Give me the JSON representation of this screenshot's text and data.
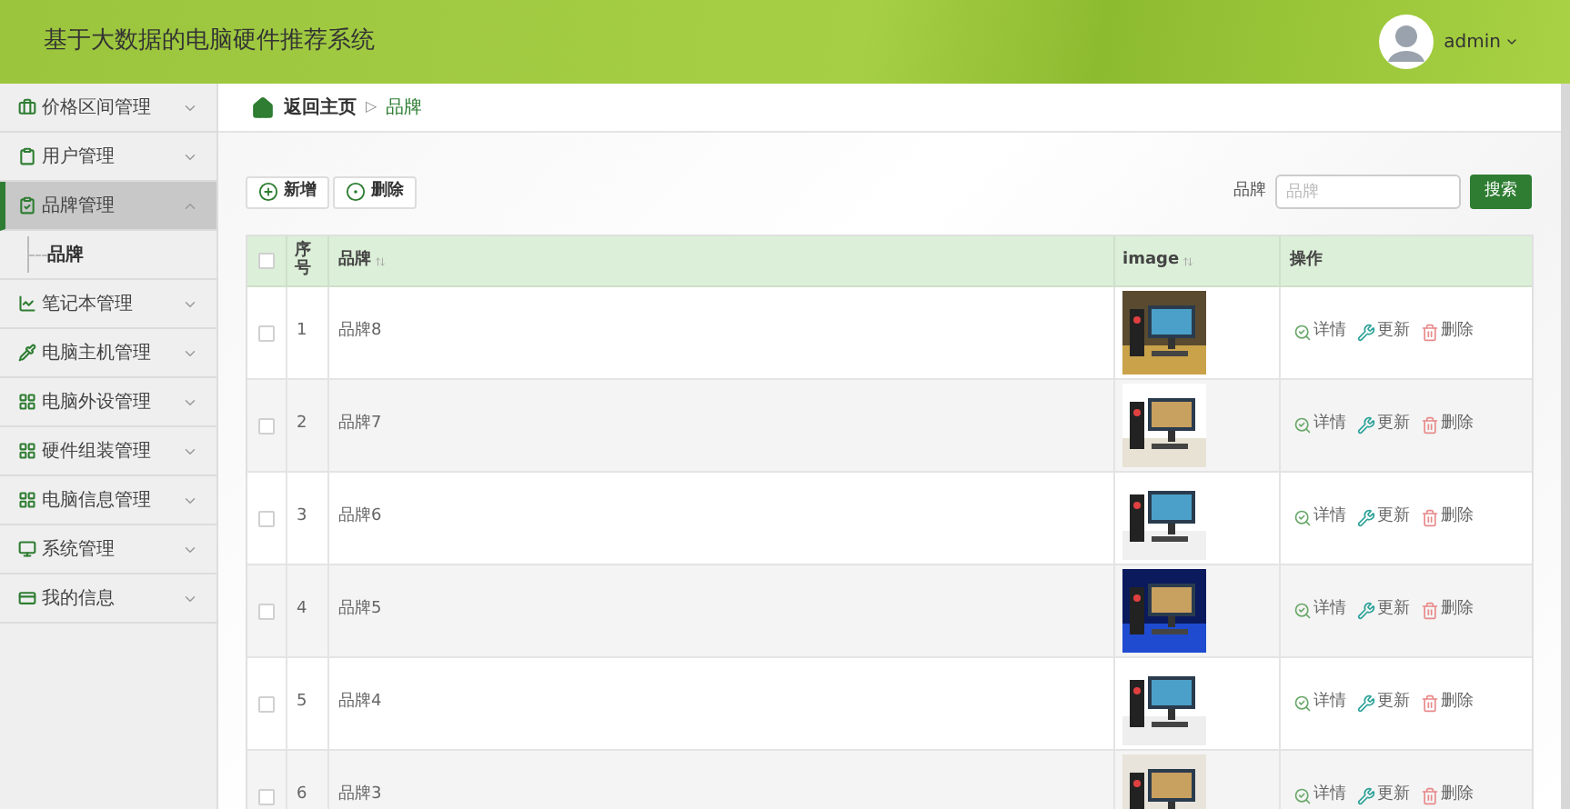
{
  "header": {
    "title": "基于大数据的电脑硬件推荐系统",
    "user": "admin"
  },
  "sidebar": {
    "items": [
      {
        "label": "价格区间管理",
        "expanded": false,
        "selected": false
      },
      {
        "label": "用户管理",
        "expanded": false,
        "selected": false
      },
      {
        "label": "品牌管理",
        "expanded": true,
        "selected": true,
        "children": [
          {
            "label": "品牌"
          }
        ]
      },
      {
        "label": "笔记本管理",
        "expanded": false,
        "selected": false
      },
      {
        "label": "电脑主机管理",
        "expanded": false,
        "selected": false
      },
      {
        "label": "电脑外设管理",
        "expanded": false,
        "selected": false
      },
      {
        "label": "硬件组装管理",
        "expanded": false,
        "selected": false
      },
      {
        "label": "电脑信息管理",
        "expanded": false,
        "selected": false
      },
      {
        "label": "系统管理",
        "expanded": false,
        "selected": false
      },
      {
        "label": "我的信息",
        "expanded": false,
        "selected": false
      }
    ]
  },
  "breadcrumb": {
    "home": "返回主页",
    "separator": "▷",
    "current": "品牌"
  },
  "toolbar": {
    "buttons": [
      "新增",
      "删除"
    ],
    "search_label": "品牌",
    "search": {
      "placeholder": "品牌"
    },
    "search_button": "搜索"
  },
  "table": {
    "header_checked": false,
    "columns": [
      "序号",
      "品牌",
      "image",
      "操作"
    ],
    "rows": [
      {
        "checked": false,
        "index": "1",
        "brand": "品牌8",
        "image": {
          "kind": "picture"
        },
        "actions": [
          "详情",
          "更新",
          "删除"
        ]
      },
      {
        "checked": false,
        "index": "2",
        "brand": "品牌7",
        "image": {
          "kind": "picture"
        },
        "actions": [
          "详情",
          "更新",
          "删除"
        ]
      },
      {
        "checked": false,
        "index": "3",
        "brand": "品牌6",
        "image": {
          "kind": "picture"
        },
        "actions": [
          "详情",
          "更新",
          "删除"
        ]
      },
      {
        "checked": false,
        "index": "4",
        "brand": "品牌5",
        "image": {
          "kind": "picture"
        },
        "actions": [
          "详情",
          "更新",
          "删除"
        ]
      },
      {
        "checked": false,
        "index": "5",
        "brand": "品牌4",
        "image": {
          "kind": "picture"
        },
        "actions": [
          "详情",
          "更新",
          "删除"
        ]
      },
      {
        "checked": false,
        "index": "6",
        "brand": "品牌3",
        "image": {
          "kind": "picture"
        },
        "actions": [
          "详情",
          "更新",
          "删除"
        ]
      }
    ]
  }
}
